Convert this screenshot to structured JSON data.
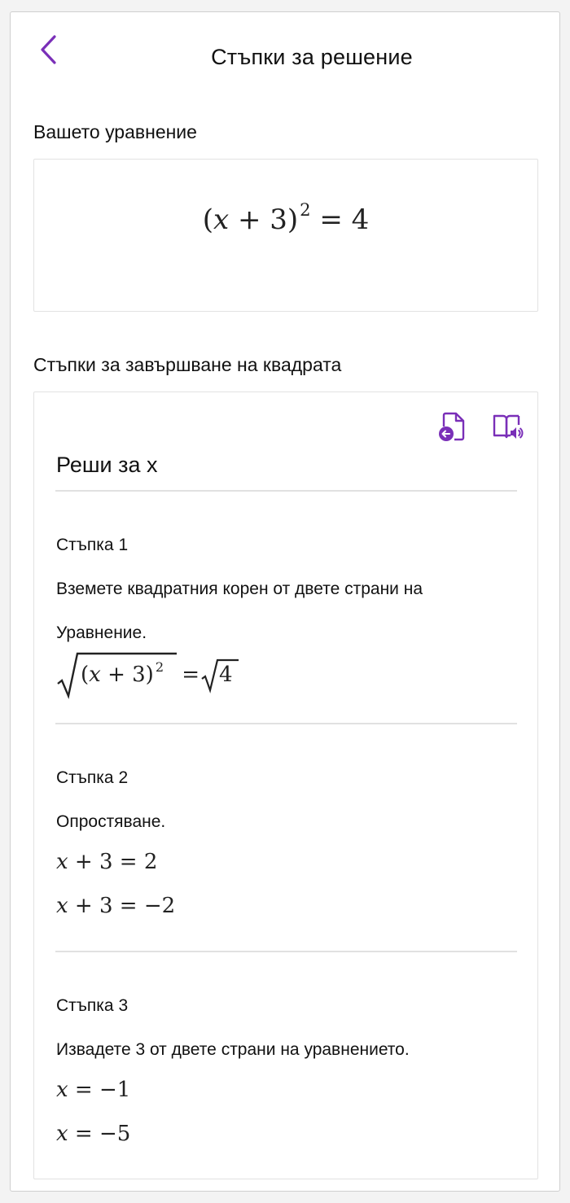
{
  "header": {
    "title": "Стъпки за решение",
    "back_icon": "chevron-left-icon"
  },
  "equation_section": {
    "heading": "Вашето уравнение",
    "equation": {
      "open": "(",
      "var": "x",
      "plus": " + 3)",
      "exp": "2",
      "rhs": " = 4"
    }
  },
  "steps_section": {
    "heading": "Стъпки за завършване на квадрата",
    "toolbar": {
      "insert_icon": "insert-to-page-icon",
      "read_icon": "immersive-reader-icon"
    },
    "solve_title": "Реши за x",
    "steps": [
      {
        "label": "Стъпка 1",
        "text_line1": "Вземете квадратния корен от двете страни на",
        "text_line2": "Уравнение.",
        "eq": {
          "inner_var": "x",
          "inner_plus": " + 3)",
          "exp": "2",
          "eq_sign": " = ",
          "rhs_radicand": "4"
        }
      },
      {
        "label": "Стъпка 2",
        "text": "Опростяване.",
        "eq1": {
          "var": "x",
          "rest": " + 3 = 2"
        },
        "eq2": {
          "var": "x",
          "rest": " + 3 = −2"
        }
      },
      {
        "label": "Стъпка 3",
        "text": "Извадете 3 от двете страни на уравнението.",
        "eq1": {
          "var": "x",
          "rest": " = −1"
        },
        "eq2": {
          "var": "x",
          "rest": " = −5"
        }
      }
    ]
  },
  "colors": {
    "accent": "#7a2fb8",
    "divider": "#e1e1e1",
    "card_border": "#e2e2e2"
  }
}
